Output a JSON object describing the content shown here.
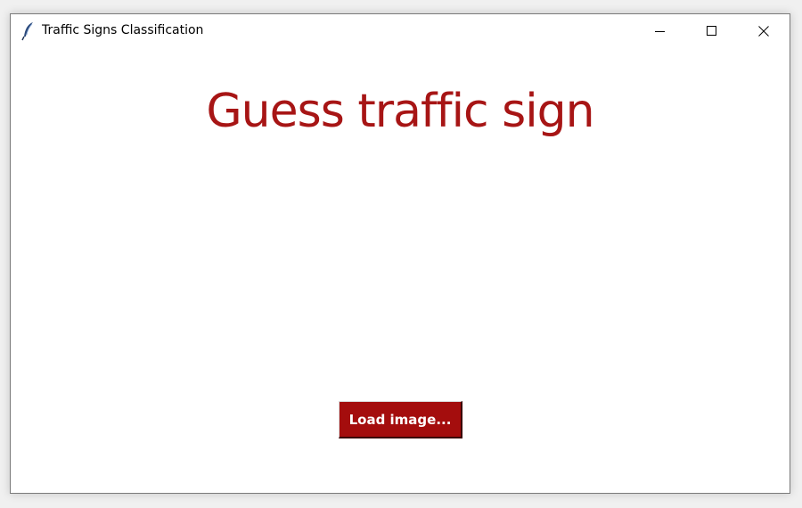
{
  "window": {
    "title": "Traffic Signs Classification",
    "app_icon": "feather-icon",
    "controls": {
      "minimize_icon": "minimize-icon",
      "maximize_icon": "maximize-icon",
      "close_icon": "close-icon"
    }
  },
  "main": {
    "heading": "Guess traffic sign",
    "load_button_label": "Load image..."
  },
  "colors": {
    "heading": "#a71515",
    "button_bg": "#a40d0d",
    "button_text": "#ffffff",
    "window_bg": "#ffffff"
  }
}
